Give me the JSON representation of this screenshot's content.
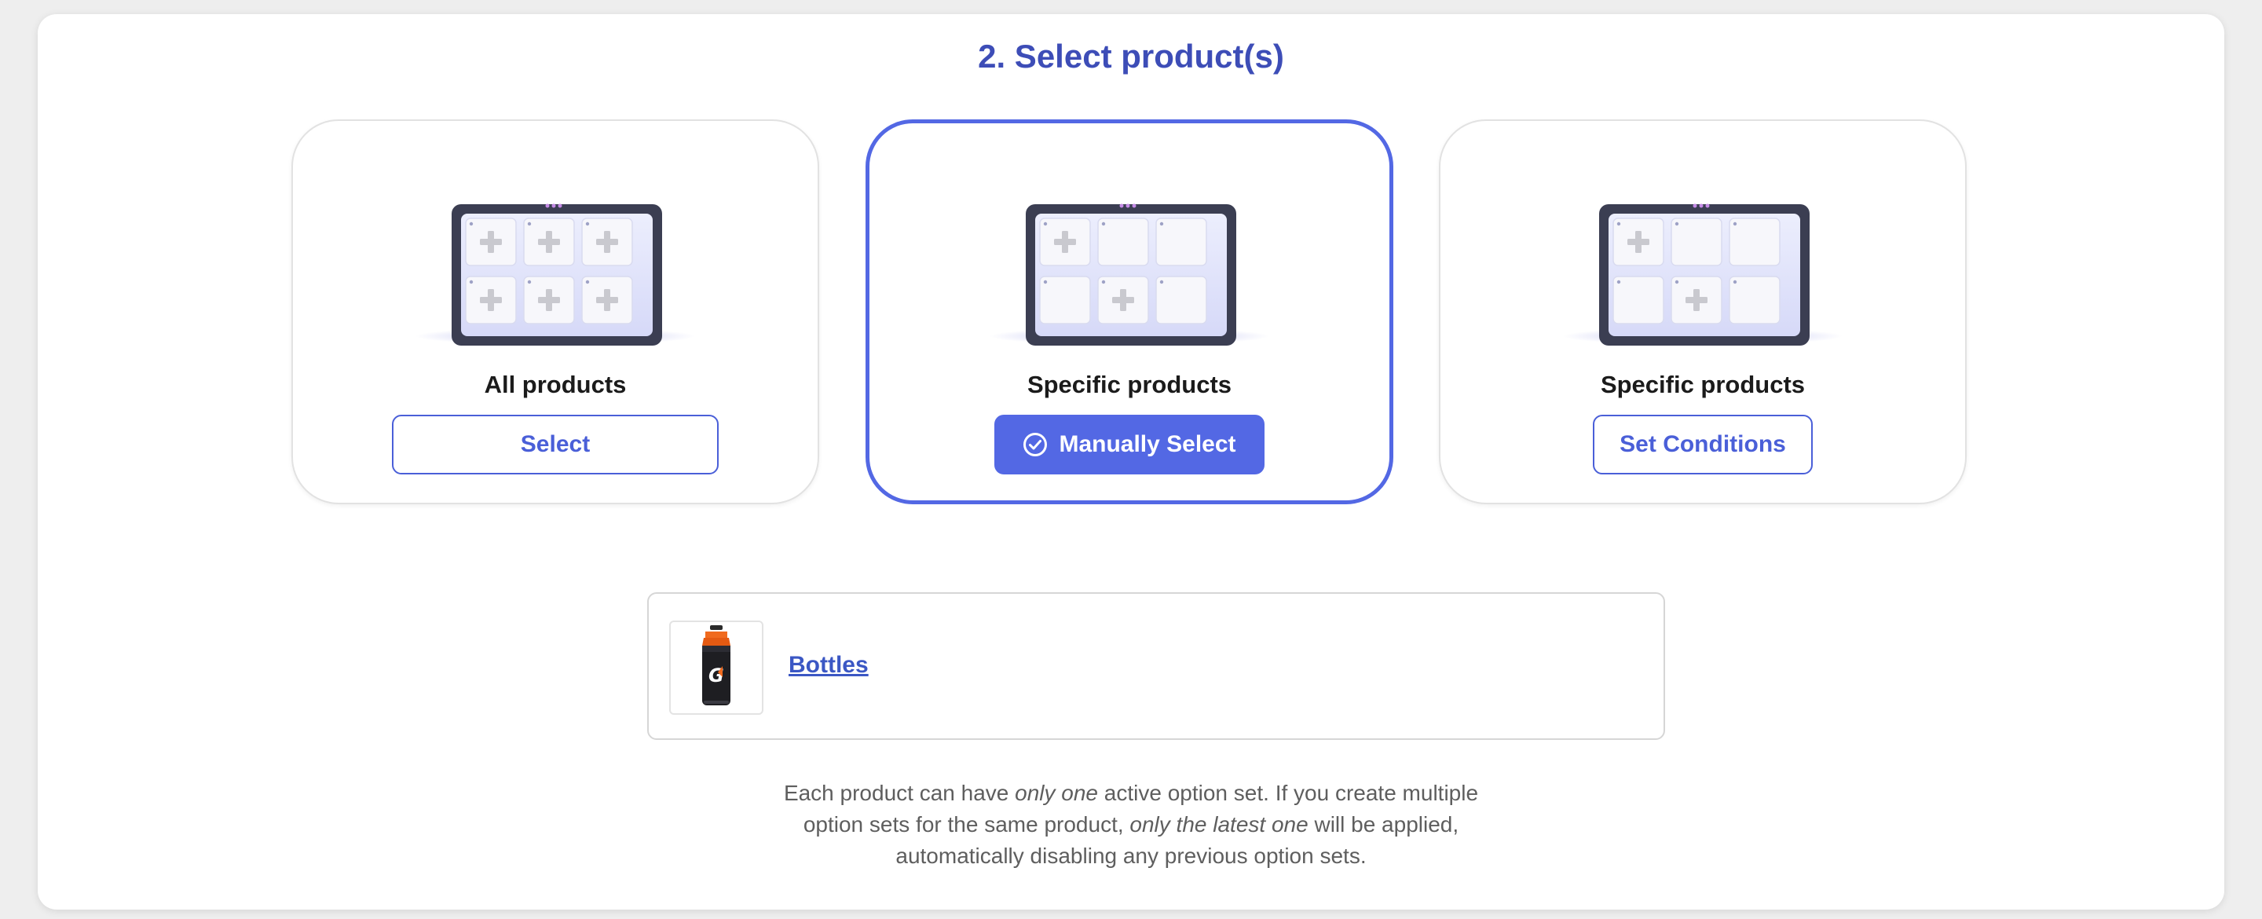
{
  "section": {
    "title": "2. Select product(s)"
  },
  "cards": {
    "all": {
      "label": "All products",
      "button": "Select",
      "illustration_icon": "tablet-grid-all-plus-icon"
    },
    "manual": {
      "label": "Specific products",
      "button": "Manually Select",
      "button_icon": "check-circle-icon",
      "selected": true,
      "illustration_icon": "tablet-grid-some-plus-icon"
    },
    "conditions": {
      "label": "Specific products",
      "button": "Set Conditions",
      "illustration_icon": "tablet-grid-some-plus-icon"
    }
  },
  "selected_products": [
    {
      "name": "Bottles",
      "thumbnail_icon": "sports-bottle-icon"
    }
  ],
  "note": {
    "line1_a": "Each product can have ",
    "line1_em": "only one",
    "line1_b": " active option set. If you create multiple",
    "line2_a": "option sets for the same product, ",
    "line2_em": "only the latest one",
    "line2_b": " will be applied,",
    "line3": "automatically disabling any previous option sets."
  },
  "colors": {
    "accent": "#5368e4",
    "title": "#3d4db7",
    "link": "#3b57c4",
    "tablet_frame": "#3b3e52",
    "tablet_screen": "#e4e6fb"
  }
}
